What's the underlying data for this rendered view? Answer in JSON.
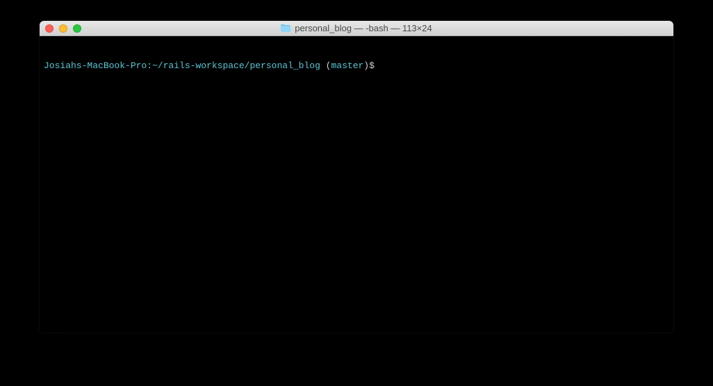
{
  "window": {
    "title": "personal_blog — -bash — 113×24",
    "folder_name": "personal_blog"
  },
  "prompt": {
    "host": "Josiahs-MacBook-Pro:",
    "path": "~/rails-workspace/personal_blog",
    "branch_open": " (",
    "branch": "master",
    "branch_close": ")",
    "symbol": "$",
    "input": ""
  },
  "colors": {
    "cyan": "#56c7d6",
    "white": "#d0d0d0"
  }
}
